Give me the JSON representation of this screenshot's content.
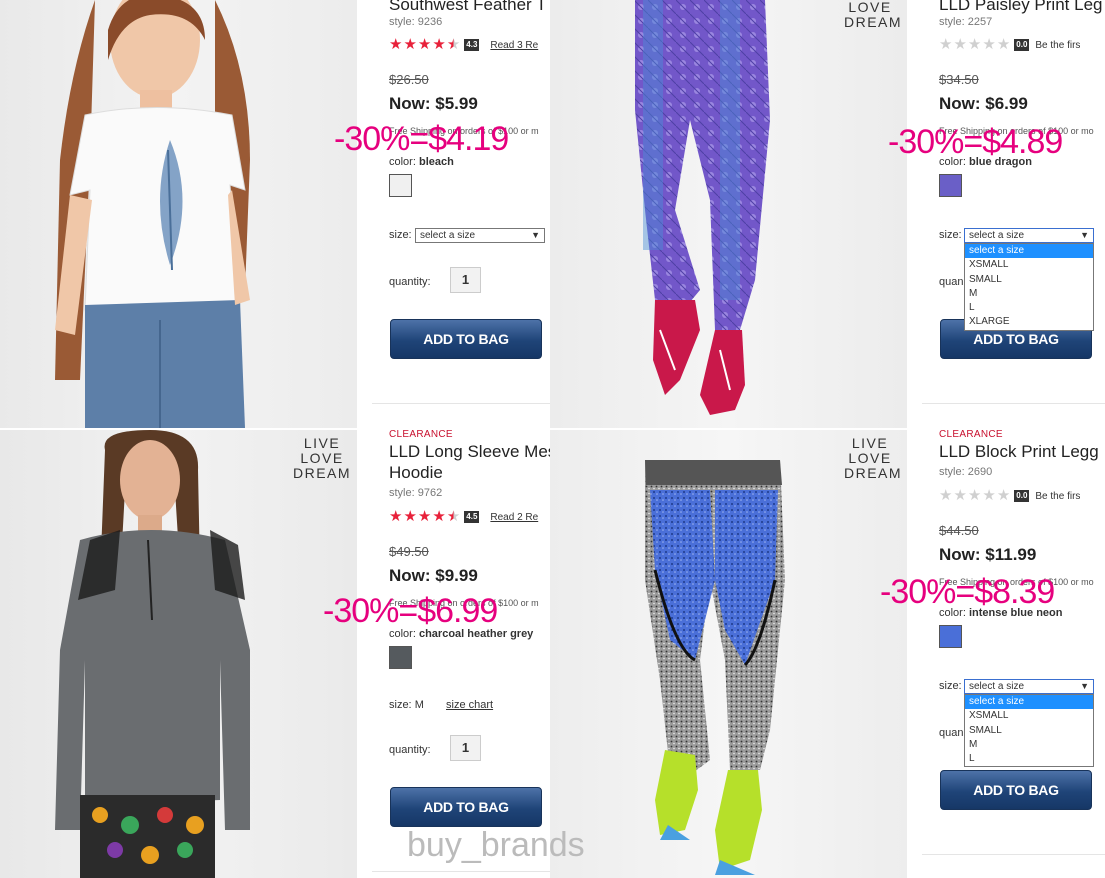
{
  "products": [
    {
      "clearance": "",
      "title_lines": [
        "Southwest Feather T"
      ],
      "style": "style: 9236",
      "rating": 4.3,
      "rating_label": "4.3",
      "review_link": "Read 3 Re",
      "was_price": "$26.50",
      "now_price": "Now: $5.99",
      "shipping": "Free Shipping on orders of $100 or m",
      "color_label": "color:",
      "color_name": "bleach",
      "swatch_color": "#f0f0f0",
      "size_label": "size:",
      "size_value": "select a size",
      "quantity_label": "quantity:",
      "quantity_value": "1",
      "add_button": "ADD TO BAG",
      "promo": "-30%=$4.19",
      "shirt_color": "#fafafa",
      "pants_color": "#5d7fa8"
    },
    {
      "clearance": "",
      "title_lines": [
        "LLD Paisley Print Leg"
      ],
      "style": "style: 2257",
      "rating": 0,
      "rating_label": "0.0",
      "review_link": "Be the firs",
      "was_price": "$34.50",
      "now_price": "Now: $6.99",
      "shipping": "Free Shipping on orders of $100 or mo",
      "color_label": "color:",
      "color_name": "blue dragon",
      "swatch_color": "#6a5fc7",
      "size_label": "size:",
      "size_value": "select a size",
      "size_options": [
        "select a size",
        "XSMALL",
        "SMALL",
        "M",
        "L",
        "XLARGE"
      ],
      "quantity_label": "quan",
      "add_button": "ADD TO BAG",
      "promo": "-30%=$4.89",
      "brand": [
        "LOVE",
        "DREAM"
      ]
    },
    {
      "clearance": "CLEARANCE",
      "title_lines": [
        "LLD Long Sleeve Mes",
        "Hoodie"
      ],
      "style": "style: 9762",
      "rating": 4.5,
      "rating_label": "4.5",
      "review_link": "Read 2 Re",
      "was_price": "$49.50",
      "now_price": "Now: $9.99",
      "shipping": "Free Shipping on orders of $100 or m",
      "color_label": "color:",
      "color_name": "charcoal heather grey",
      "swatch_color": "#555a5e",
      "size_label": "size:",
      "size_value": "M",
      "size_chart": "size chart",
      "quantity_label": "quantity:",
      "quantity_value": "1",
      "add_button": "ADD TO BAG",
      "promo": "-30%=$6.99",
      "brand": [
        "LIVE",
        "LOVE",
        "DREAM"
      ]
    },
    {
      "clearance": "CLEARANCE",
      "title_lines": [
        "LLD Block Print Legg"
      ],
      "style": "style: 2690",
      "rating": 0,
      "rating_label": "0.0",
      "review_link": "Be the firs",
      "was_price": "$44.50",
      "now_price": "Now: $11.99",
      "shipping": "Free Shipping on orders of $100 or mo",
      "color_label": "color:",
      "color_name": "intense blue neon",
      "swatch_color": "#4a6fd8",
      "size_label": "size:",
      "size_value": "select a size",
      "size_options": [
        "select a size",
        "XSMALL",
        "SMALL",
        "M",
        "L"
      ],
      "quantity_label": "quan",
      "add_button": "ADD TO BAG",
      "promo": "-30%=$8.39",
      "brand": [
        "LIVE",
        "LOVE",
        "DREAM"
      ]
    }
  ],
  "watermark": "buy_brands",
  "colors": {
    "promo": "#e6007e",
    "clearance": "#c8102e",
    "star_on": "#e8213a",
    "star_off": "#d0d0d0",
    "button": "#1f4478"
  }
}
